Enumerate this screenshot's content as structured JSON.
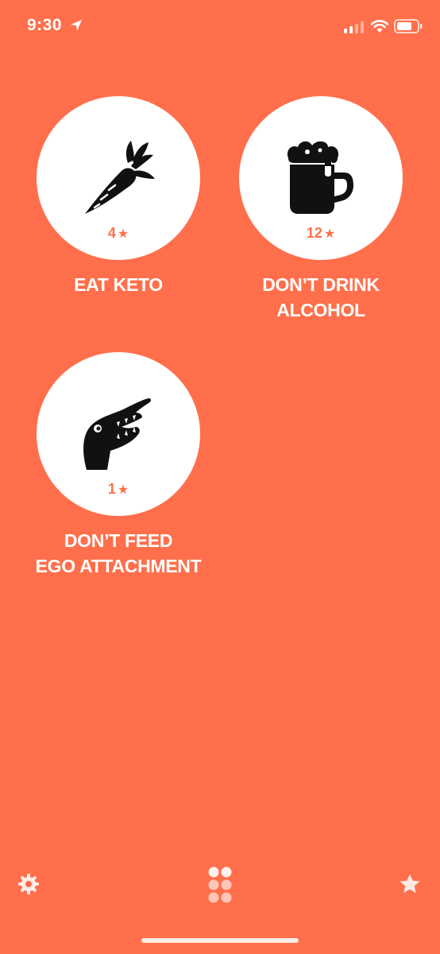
{
  "status_bar": {
    "time": "9:30"
  },
  "habits": [
    {
      "name": "EAT KETO",
      "stars": "4",
      "icon": "carrot-icon"
    },
    {
      "name": "DON’T DRINK ALCOHOL",
      "stars": "12",
      "icon": "beer-mug-icon"
    },
    {
      "name": "DON’T FEED\nEGO ATTACHMENT",
      "stars": "1",
      "icon": "crocodile-icon"
    }
  ],
  "toolbar": {
    "settings_icon": "gear-icon",
    "grid_icon": "grid-dots-icon",
    "favorites_icon": "star-icon"
  },
  "colors": {
    "background": "#ff6f4b",
    "tile": "#ffffff",
    "icon": "#111111"
  }
}
